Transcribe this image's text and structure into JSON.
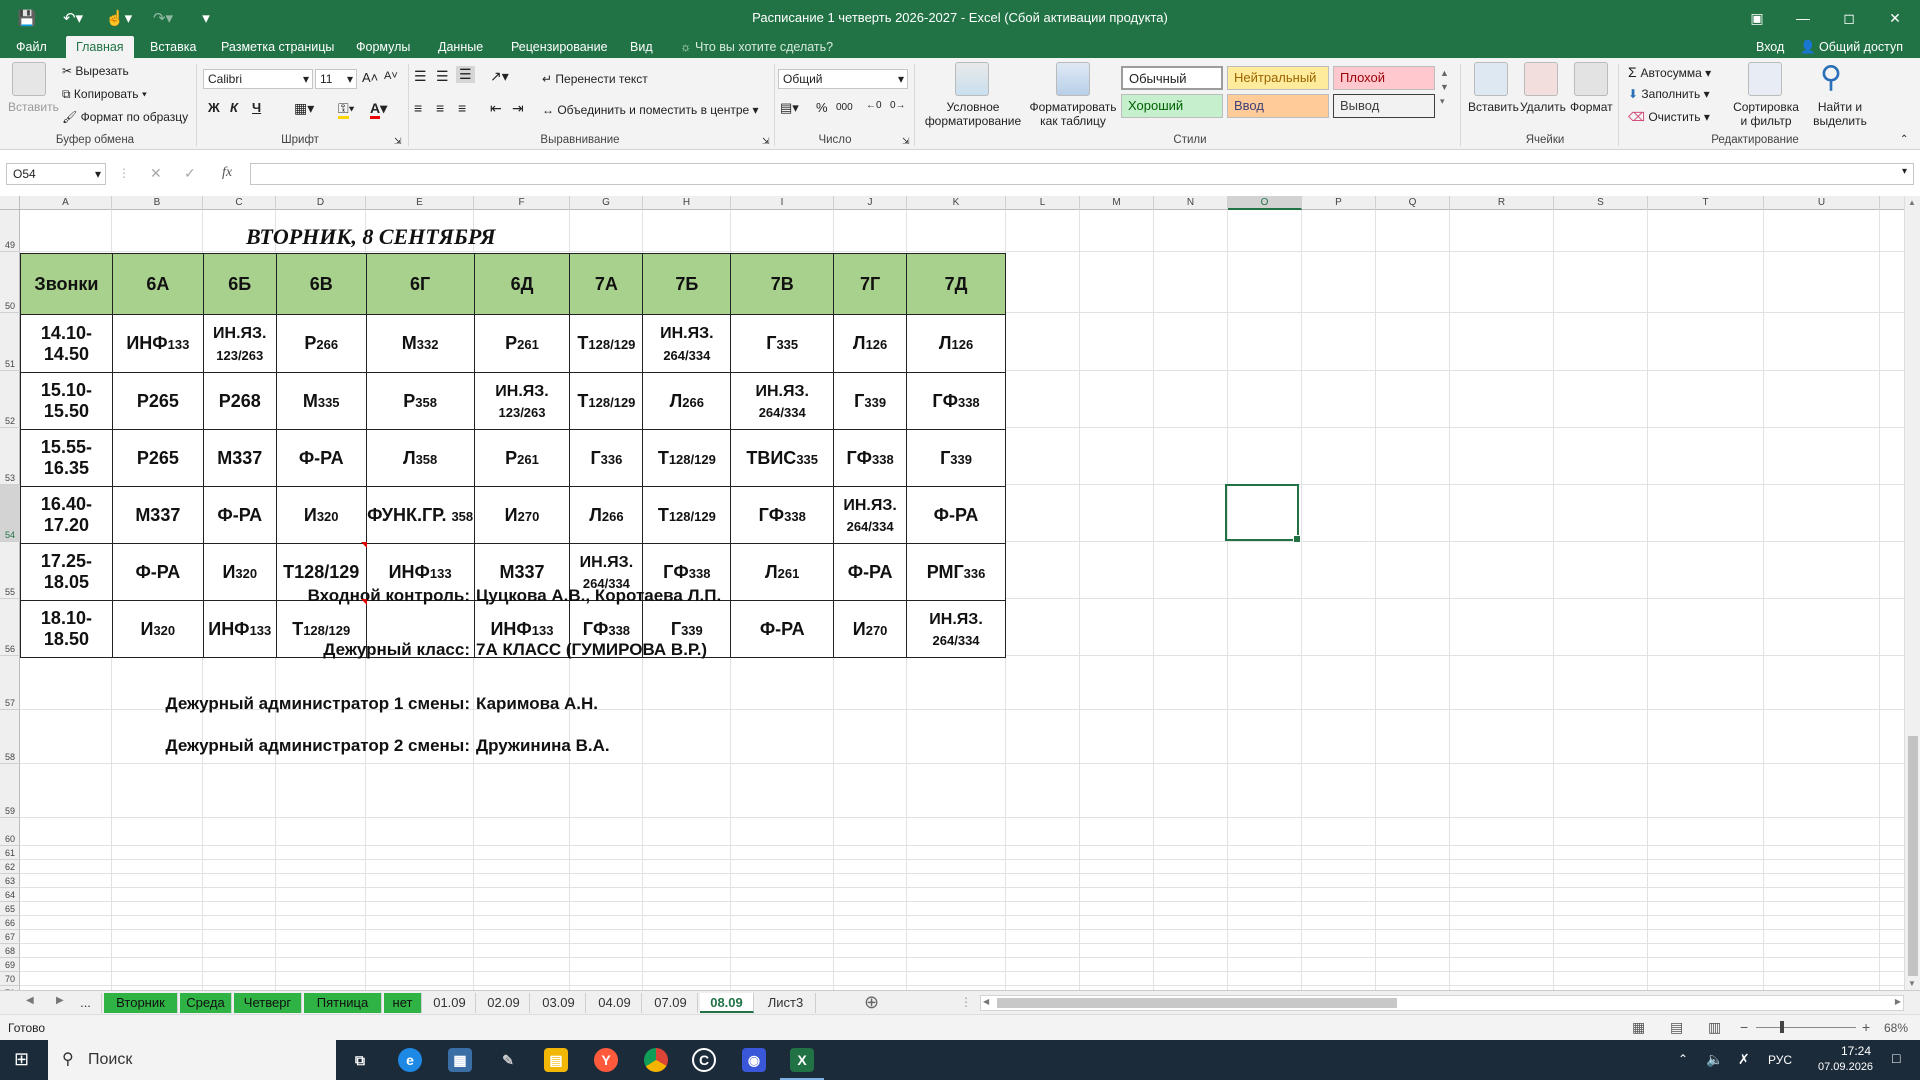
{
  "window": {
    "title": "Расписание 1 четверть 2026-2027 - Excel (Сбой активации продукта)"
  },
  "ribbon_tabs": [
    "Файл",
    "Главная",
    "Вставка",
    "Разметка страницы",
    "Формулы",
    "Данные",
    "Рецензирование",
    "Вид"
  ],
  "tell_me": "Что вы хотите сделать?",
  "account": {
    "login": "Вход",
    "share": "Общий доступ"
  },
  "clipboard": {
    "paste": "Вставить",
    "cut": "Вырезать",
    "copy": "Копировать",
    "format_painter": "Формат по образцу",
    "label": "Буфер обмена"
  },
  "font": {
    "name": "Calibri",
    "size": "11",
    "bold": "Ж",
    "italic": "К",
    "underline": "Ч",
    "label": "Шрифт"
  },
  "alignment": {
    "wrap": "Перенести текст",
    "merge": "Объединить и поместить в центре",
    "label": "Выравнивание"
  },
  "number": {
    "format": "Общий",
    "label": "Число"
  },
  "styles": {
    "conditional": "Условное форматирование",
    "as_table": "Форматировать как таблицу",
    "normal": "Обычный",
    "neutral": "Нейтральный",
    "bad": "Плохой",
    "good": "Хороший",
    "input": "Ввод",
    "output": "Вывод",
    "label": "Стили"
  },
  "cells": {
    "insert": "Вставить",
    "delete": "Удалить",
    "format": "Формат",
    "label": "Ячейки"
  },
  "editing": {
    "autosum": "Автосумма",
    "fill": "Заполнить",
    "clear": "Очистить",
    "sort": "Сортировка и фильтр",
    "find": "Найти и выделить",
    "label": "Редактирование"
  },
  "formula_bar": {
    "name_box": "O54",
    "fx": "fx",
    "value": ""
  },
  "columns": [
    "A",
    "B",
    "C",
    "D",
    "E",
    "F",
    "G",
    "H",
    "I",
    "J",
    "K",
    "L",
    "M",
    "N",
    "O",
    "P",
    "Q",
    "R",
    "S",
    "T",
    "U"
  ],
  "rows": [
    "49",
    "50",
    "51",
    "52",
    "53",
    "54",
    "55",
    "56",
    "57",
    "58",
    "59",
    "60",
    "61",
    "62",
    "63",
    "64",
    "65",
    "66",
    "67",
    "68",
    "69",
    "70",
    "71"
  ],
  "schedule": {
    "day_title": "ВТОРНИК, 8 СЕНТЯБРЯ",
    "header": [
      "Звонки",
      "6А",
      "6Б",
      "6В",
      "6Г",
      "6Д",
      "7А",
      "7Б",
      "7В",
      "7Г",
      "7Д"
    ],
    "rows": [
      [
        [
          "14.10-14.50",
          ""
        ],
        [
          "ИНФ",
          "133"
        ],
        [
          "ИН.ЯЗ.",
          "123/263"
        ],
        [
          "Р",
          "266"
        ],
        [
          "М",
          "332"
        ],
        [
          "Р",
          "261"
        ],
        [
          "Т",
          "128/129"
        ],
        [
          "ИН.ЯЗ.",
          "264/334"
        ],
        [
          "Г",
          "335"
        ],
        [
          "Л",
          "126"
        ],
        [
          "Л",
          "126"
        ]
      ],
      [
        [
          "15.10-15.50",
          ""
        ],
        [
          "Р265",
          ""
        ],
        [
          "Р268",
          ""
        ],
        [
          "М",
          "335"
        ],
        [
          "Р",
          "358"
        ],
        [
          "ИН.ЯЗ.",
          "123/263"
        ],
        [
          "Т",
          "128/129"
        ],
        [
          "Л",
          "266"
        ],
        [
          "ИН.ЯЗ.",
          "264/334"
        ],
        [
          "Г",
          "339"
        ],
        [
          "ГФ",
          "338"
        ]
      ],
      [
        [
          "15.55-16.35",
          ""
        ],
        [
          "Р265",
          ""
        ],
        [
          "М337",
          ""
        ],
        [
          "Ф-РА",
          ""
        ],
        [
          "Л",
          "358"
        ],
        [
          "Р",
          "261"
        ],
        [
          "Г",
          "336"
        ],
        [
          "Т",
          "128/129"
        ],
        [
          "ТВИС",
          "335"
        ],
        [
          "ГФ",
          "338"
        ],
        [
          "Г",
          "339"
        ]
      ],
      [
        [
          "16.40-17.20",
          ""
        ],
        [
          "М337",
          ""
        ],
        [
          "Ф-РА",
          ""
        ],
        [
          "И",
          "320"
        ],
        [
          "ФУНК.ГР. ",
          "358"
        ],
        [
          "И",
          "270"
        ],
        [
          "Л",
          "266"
        ],
        [
          "Т",
          "128/129"
        ],
        [
          "ГФ",
          "338"
        ],
        [
          "ИН.ЯЗ.",
          "264/334"
        ],
        [
          "Ф-РА",
          ""
        ]
      ],
      [
        [
          "17.25-18.05",
          ""
        ],
        [
          "Ф-РА",
          ""
        ],
        [
          "И",
          "320"
        ],
        [
          "Т128/129",
          ""
        ],
        [
          "ИНФ",
          "133"
        ],
        [
          "М337",
          ""
        ],
        [
          "ИН.ЯЗ.",
          "264/334"
        ],
        [
          "ГФ",
          "338"
        ],
        [
          "Л",
          "261"
        ],
        [
          "Ф-РА",
          ""
        ],
        [
          "РМГ",
          "336"
        ]
      ],
      [
        [
          "18.10-18.50",
          ""
        ],
        [
          "И",
          "320"
        ],
        [
          "ИНФ",
          "133"
        ],
        [
          "Т",
          "128/129"
        ],
        [
          "",
          ""
        ],
        [
          "ИНФ",
          "133"
        ],
        [
          "ГФ",
          "338"
        ],
        [
          "Г",
          "339"
        ],
        [
          "Ф-РА",
          ""
        ],
        [
          "И",
          "270"
        ],
        [
          "ИН.ЯЗ.",
          "264/334"
        ]
      ]
    ]
  },
  "info": [
    {
      "label": "Входной контроль:",
      "value": "Цуцкова А.В., Коротаева Л.П."
    },
    {
      "label": "Дежурный класс:",
      "value": "7А КЛАСС (ГУМИРОВА В.Р.)"
    },
    {
      "label": "Дежурный администратор 1 смены:",
      "value": "Каримова А.Н."
    },
    {
      "label": "Дежурный администратор 2 смены:",
      "value": "Дружинина В.А."
    }
  ],
  "sheet_tabs": [
    "...",
    "Вторник",
    "Среда",
    "Четверг",
    "Пятница",
    "нет",
    "01.09",
    "02.09",
    "03.09",
    "04.09",
    "07.09",
    "08.09",
    "Лист3"
  ],
  "active_sheet": "08.09",
  "status": {
    "ready": "Готово",
    "zoom": "68%"
  },
  "taskbar": {
    "search": "Поиск",
    "lang": "РУС",
    "time": "17:24",
    "date": "07.09.2026"
  },
  "colors": {
    "excel_green": "#217346",
    "header_fill": "#a9d18e",
    "tab_green": "#2fb344"
  }
}
